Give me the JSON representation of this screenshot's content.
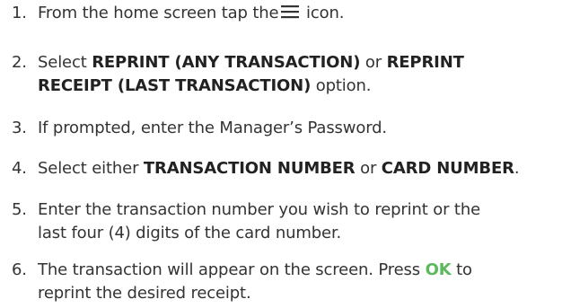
{
  "steps": [
    {
      "number": "1.",
      "before_icon": "From the home screen tap the",
      "icon": "menu-icon",
      "after_icon": " icon."
    },
    {
      "number": "2.",
      "part1": "Select ",
      "bold1": "REPRINT (ANY TRANSACTION)",
      "part2": " or ",
      "bold2": "REPRINT",
      "bold3": "RECEIPT (LAST TRANSACTION)",
      "part3": " option."
    },
    {
      "number": "3.",
      "text": "If prompted, enter the Manager’s Password."
    },
    {
      "number": "4.",
      "part1": "Select either ",
      "bold1": "TRANSACTION NUMBER",
      "part2": " or ",
      "bold2": "CARD NUMBER",
      "part3": "."
    },
    {
      "number": "5.",
      "line1": "Enter the transaction number you wish to reprint or the",
      "line2": "last four (4) digits of the card number."
    },
    {
      "number": "6.",
      "part1": "The transaction will appear on the screen. Press ",
      "ok": "OK",
      "part2": " to",
      "line2": "reprint the desired receipt."
    }
  ],
  "colors": {
    "text": "#333333",
    "ok_highlight": "#5cb85c"
  }
}
